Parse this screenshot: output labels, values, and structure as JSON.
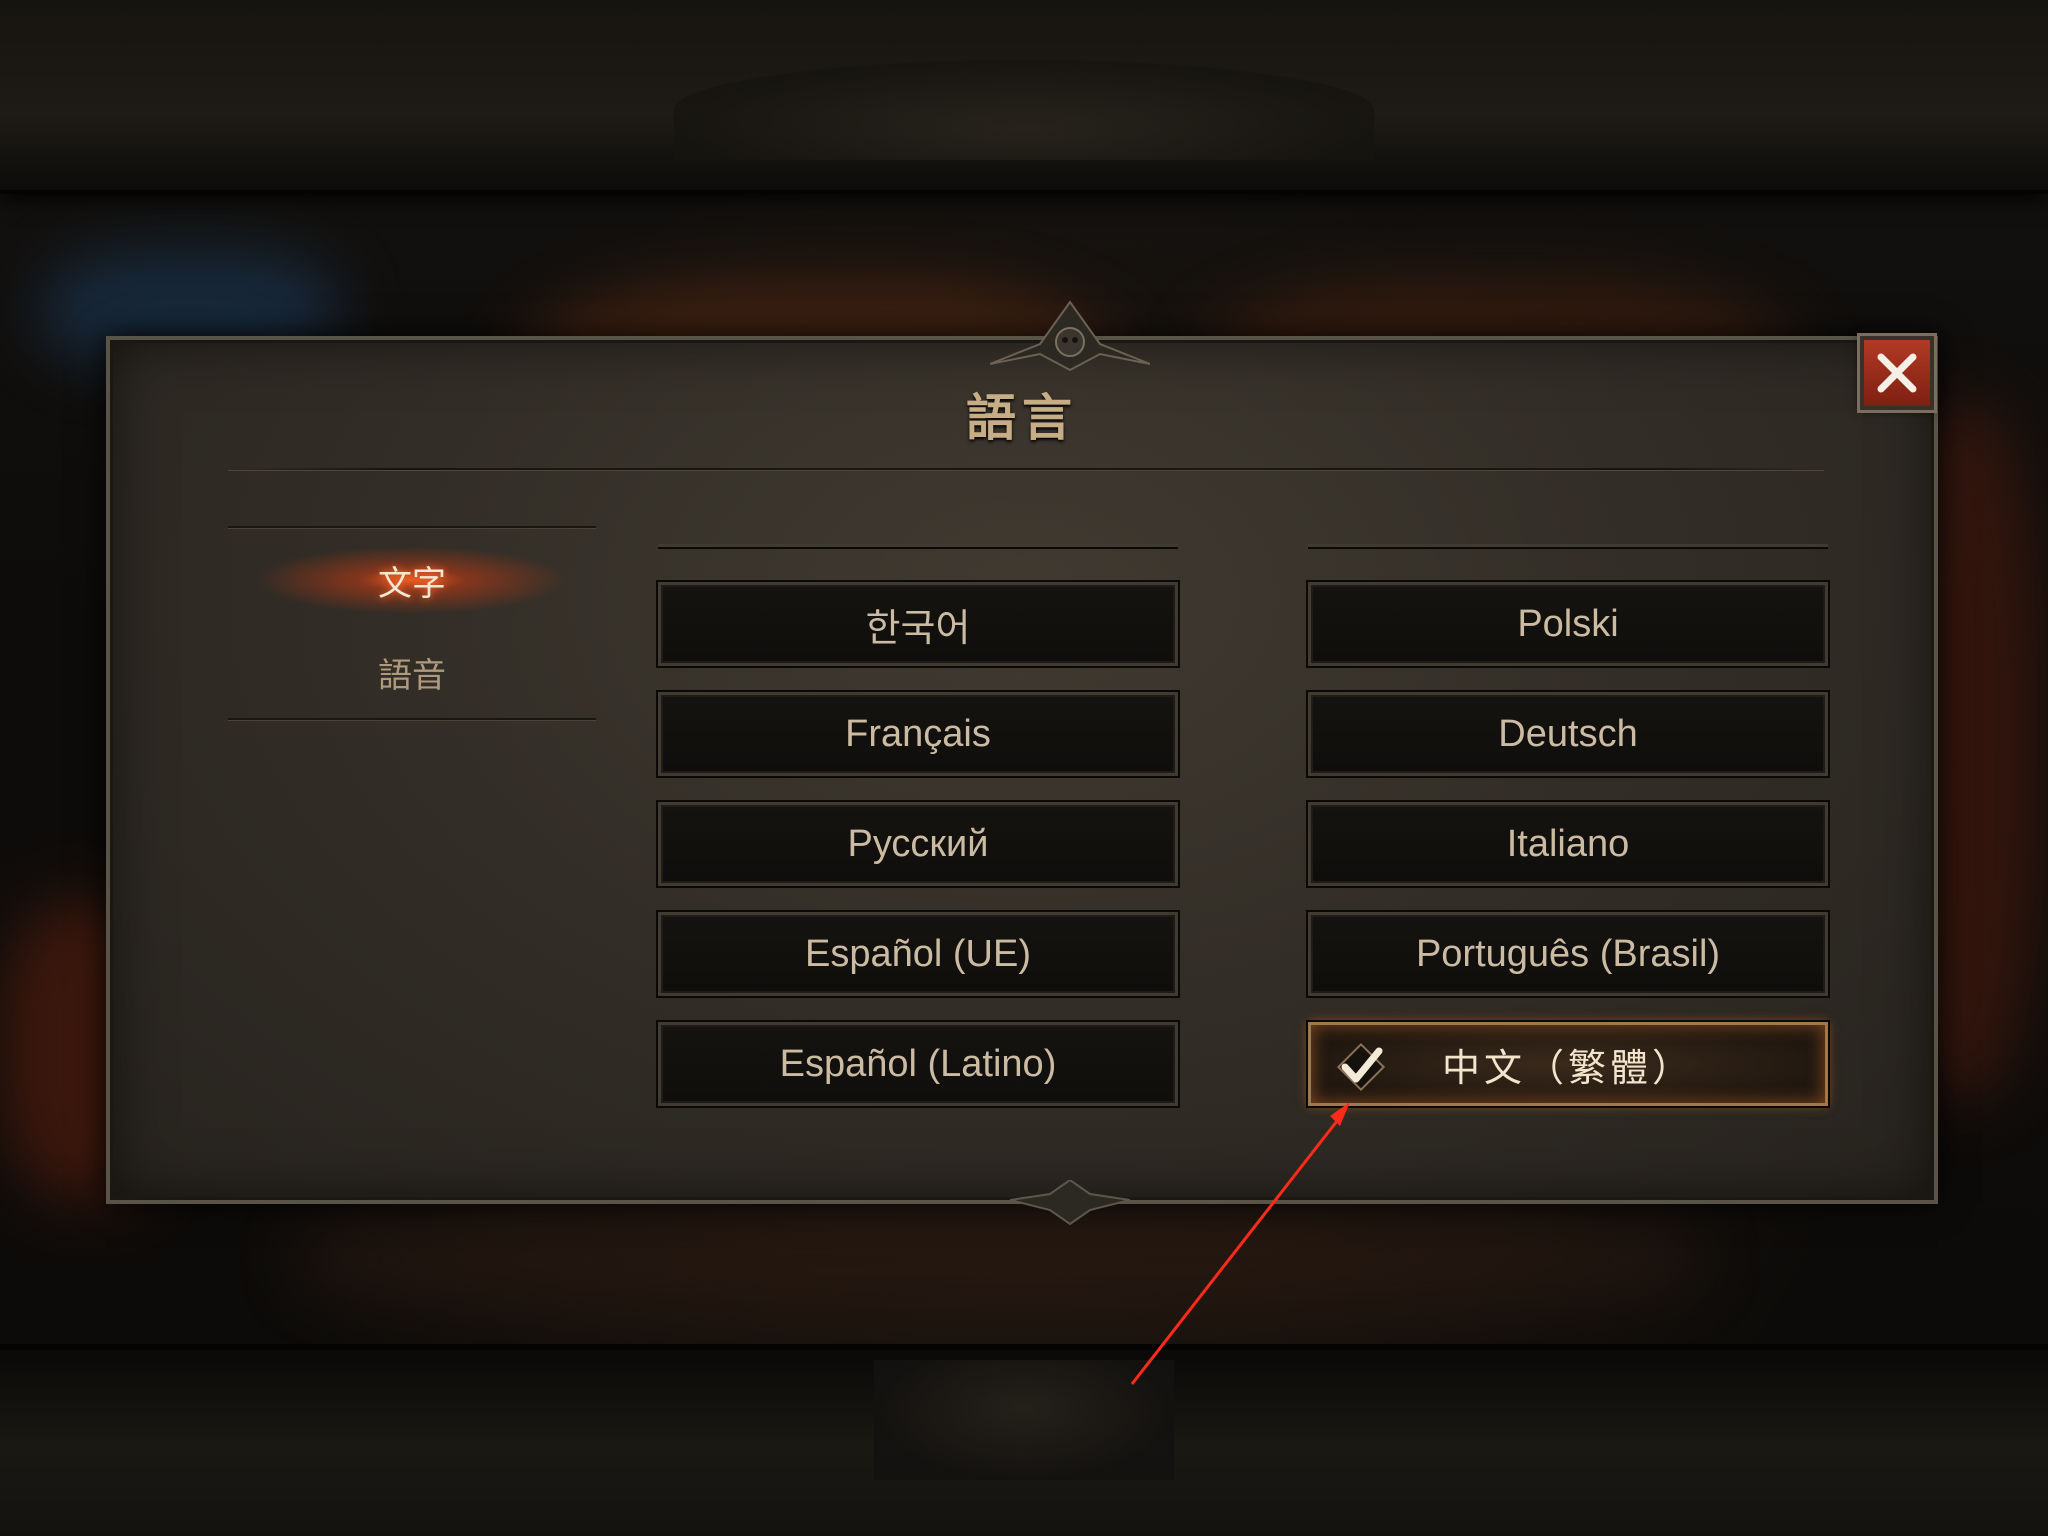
{
  "dialog": {
    "title": "語言"
  },
  "tabs": [
    {
      "label": "文字",
      "active": true
    },
    {
      "label": "語音",
      "active": false
    }
  ],
  "languages": {
    "left": [
      "한국어",
      "Français",
      "Русский",
      "Español (UE)",
      "Español (Latino)"
    ],
    "right": [
      "Polski",
      "Deutsch",
      "Italiano",
      "Português (Brasil)",
      "中文（繁體）"
    ]
  },
  "selected_language": "中文（繁體）",
  "icons": {
    "close": "close-icon",
    "check": "check-icon"
  },
  "colors": {
    "title": "#c7ad85",
    "close_button": "#9a2c1a",
    "selected_border": "#a0784a",
    "tab_glow": "#ff6a2a",
    "annotation_arrow": "#ff2a1a"
  }
}
